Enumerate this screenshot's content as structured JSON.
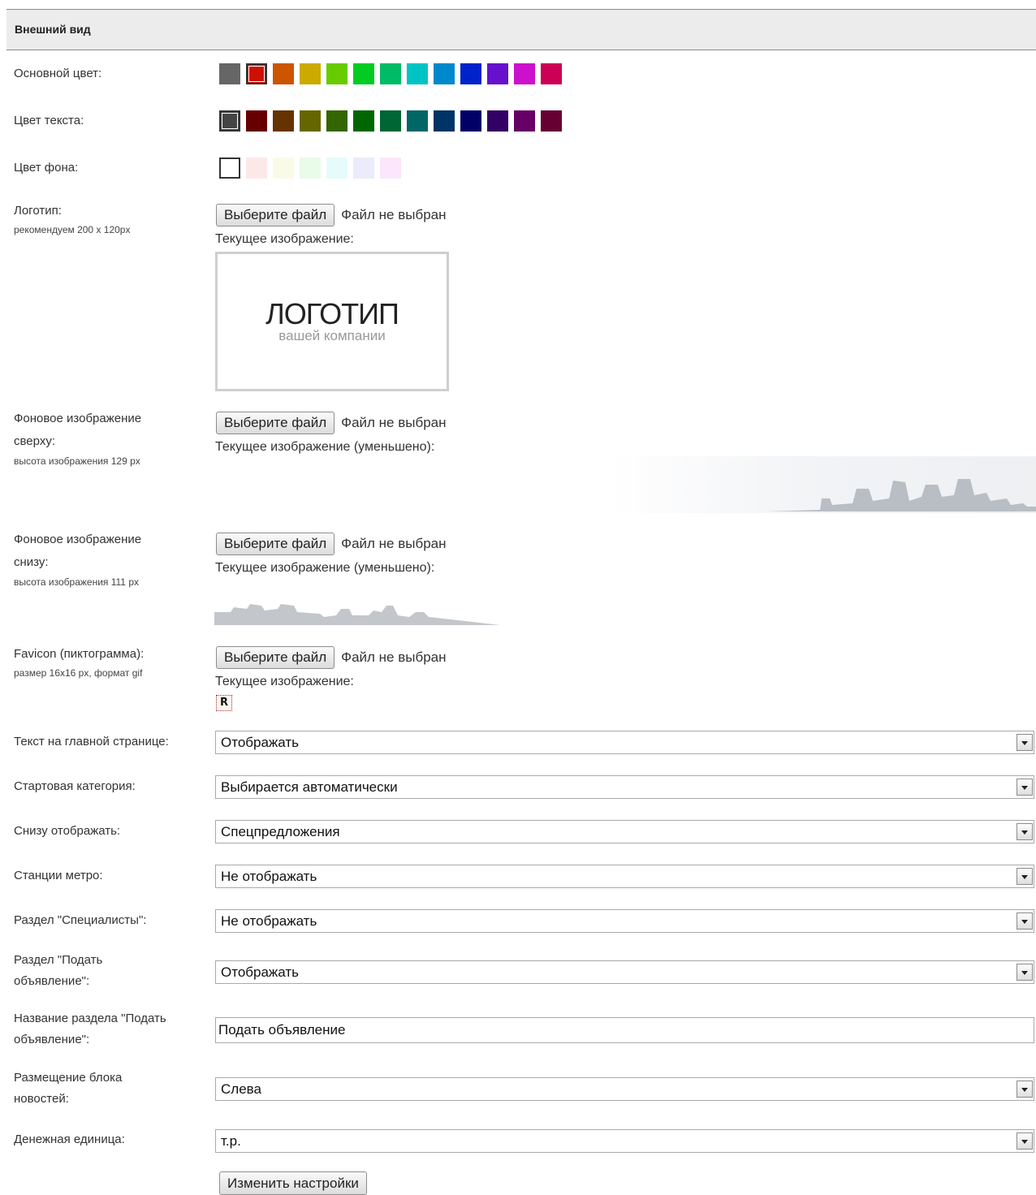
{
  "section": {
    "title": "Внешний вид"
  },
  "main_color": {
    "label": "Основной цвет:",
    "swatches": [
      "#666666",
      "#cc1100",
      "#cc5500",
      "#ccaa00",
      "#66cc00",
      "#00cc22",
      "#00bb66",
      "#00c4c4",
      "#0088cc",
      "#0022cc",
      "#6611cc",
      "#cc11cc",
      "#cc0055"
    ],
    "selected": 1
  },
  "text_color": {
    "label": "Цвет текста:",
    "swatches": [
      "#444444",
      "#660000",
      "#663300",
      "#666600",
      "#336600",
      "#006600",
      "#006633",
      "#006666",
      "#003366",
      "#000066",
      "#330066",
      "#660066",
      "#660033"
    ],
    "selected": 0
  },
  "bg_color": {
    "label": "Цвет фона:",
    "swatches": [
      "#ffffff",
      "#fde8e8",
      "#fafbe6",
      "#e9fbe9",
      "#e6fbfb",
      "#ecebfb",
      "#fbe6fb"
    ],
    "selected": 0
  },
  "logo": {
    "label": "Логотип:",
    "note": "рекомендуем 200 x 120px",
    "button": "Выберите файл",
    "status": "Файл не выбран",
    "current": "Текущее изображение:",
    "image_main": "ЛОГОТИП",
    "image_sub": "вашей компании"
  },
  "top_bg": {
    "label": "Фоновое изображение сверху:",
    "note": "высота изображения 129 px",
    "button": "Выберите файл",
    "status": "Файл не выбран",
    "current": "Текущее изображение (уменьшено):"
  },
  "bottom_bg": {
    "label": "Фоновое изображение снизу:",
    "note": "высота изображения 111 px",
    "button": "Выберите файл",
    "status": "Файл не выбран",
    "current": "Текущее изображение (уменьшено):"
  },
  "favicon": {
    "label": "Favicon (пиктограмма):",
    "note": "размер 16x16 px, формат gif",
    "button": "Выберите файл",
    "status": "Файл не выбран",
    "current": "Текущее изображение:",
    "glyph": "R"
  },
  "fields": {
    "main_text": {
      "label": "Текст на главной странице:",
      "value": "Отображать"
    },
    "start_category": {
      "label": "Стартовая категория:",
      "value": "Выбирается автоматически"
    },
    "bottom_show": {
      "label": "Снизу отображать:",
      "value": "Спецпредложения"
    },
    "metro": {
      "label": "Станции метро:",
      "value": "Не отображать"
    },
    "specialists": {
      "label": "Раздел \"Специалисты\":",
      "value": "Не отображать"
    },
    "post_ad": {
      "label": "Раздел \"Подать объявление\":",
      "value": "Отображать"
    },
    "post_ad_name": {
      "label": "Название раздела \"Подать объявление\":",
      "value": "Подать объявление"
    },
    "news_block": {
      "label": "Размещение блока новостей:",
      "value": "Слева"
    },
    "currency": {
      "label": "Денежная единица:",
      "value": "т.р."
    }
  },
  "submit": {
    "label": "Изменить настройки"
  }
}
